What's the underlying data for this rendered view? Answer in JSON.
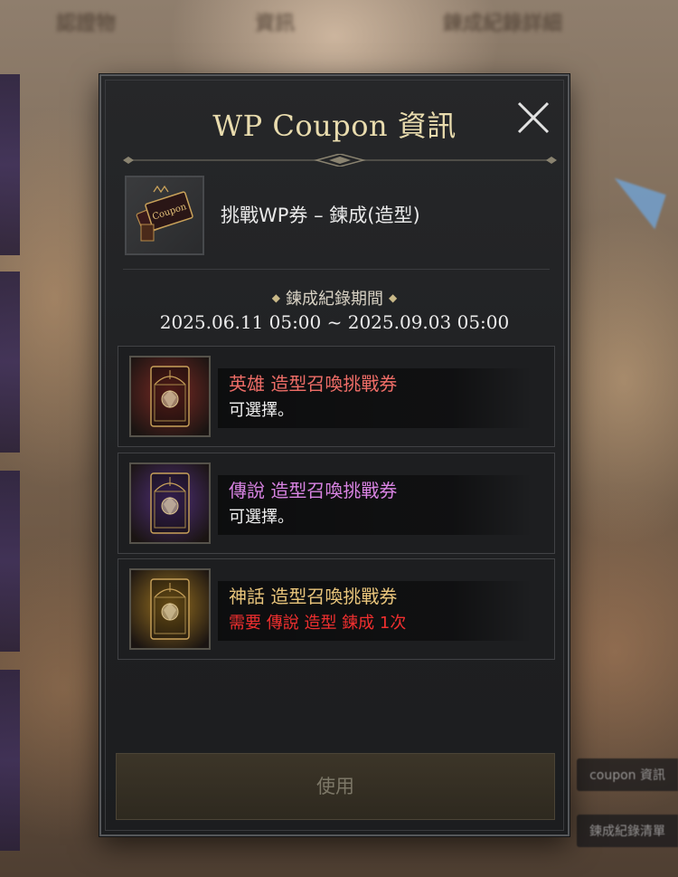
{
  "background": {
    "blurred_texts": [
      "認證物",
      "資訊",
      "鍊成紀錄詳細"
    ],
    "right_pills": [
      "coupon 資訊",
      "鍊成紀錄清單"
    ]
  },
  "modal": {
    "title": "WP Coupon 資訊",
    "close_icon": "close-icon",
    "coupon": {
      "name": "挑戰WP券 – 鍊成(造型)",
      "icon_text": "Coupon",
      "icon": "coupon-cards-icon"
    },
    "period": {
      "label": "鍊成紀錄期間",
      "value": "2025.06.11 05:00 ~ 2025.09.03 05:00"
    },
    "tickets": [
      {
        "name": "英雄 造型召喚挑戰券",
        "status": "可選擇。",
        "name_color": "#ee6d67",
        "status_color": "#f2f2f2",
        "tier_color": "#7a2a24",
        "icon": "hero-costume-ticket-icon"
      },
      {
        "name": "傳說 造型召喚挑戰券",
        "status": "可選擇。",
        "name_color": "#d883e2",
        "status_color": "#f2f2f2",
        "tier_color": "#4f2f78",
        "icon": "legend-costume-ticket-icon"
      },
      {
        "name": "神話 造型召喚挑戰券",
        "status": "需要 傳說 造型 鍊成  1次",
        "name_color": "#e9c57b",
        "status_color": "#ef2f2f",
        "tier_color": "#9a7220",
        "icon": "myth-costume-ticket-icon"
      }
    ],
    "use_button": "使用"
  }
}
